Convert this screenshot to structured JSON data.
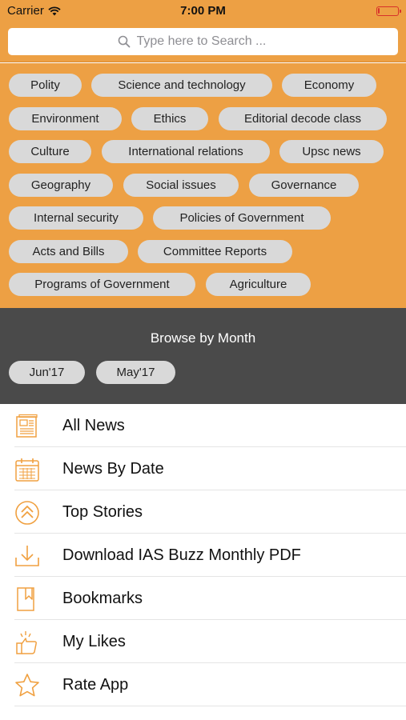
{
  "status_bar": {
    "carrier": "Carrier",
    "time": "7:00 PM",
    "battery_level": 0.1
  },
  "search": {
    "placeholder": "Type here to Search ..."
  },
  "tags": [
    "Polity",
    "Science and technology",
    "Economy",
    "Environment",
    "Ethics",
    "Editorial decode class",
    "Culture",
    "International relations",
    "Upsc news",
    "Geography",
    "Social issues",
    "Governance",
    "Internal security",
    "Policies of Government",
    "Acts and Bills",
    "Committee Reports",
    "Programs of Government",
    "Agriculture"
  ],
  "browse": {
    "title": "Browse by Month",
    "months": [
      "Jun'17",
      "May'17"
    ]
  },
  "menu": [
    {
      "label": "All News",
      "icon": "newspaper-icon"
    },
    {
      "label": "News By Date",
      "icon": "calendar-icon"
    },
    {
      "label": "Top Stories",
      "icon": "double-chevron-up-icon"
    },
    {
      "label": "Download IAS Buzz Monthly PDF",
      "icon": "download-icon"
    },
    {
      "label": "Bookmarks",
      "icon": "bookmark-icon"
    },
    {
      "label": "My Likes",
      "icon": "thumbs-up-icon"
    },
    {
      "label": "Rate App",
      "icon": "star-icon"
    }
  ],
  "colors": {
    "accent": "#eda044",
    "icon": "#f0a040",
    "dark_panel": "#4a4a4a",
    "chip": "#d9d9d9"
  }
}
